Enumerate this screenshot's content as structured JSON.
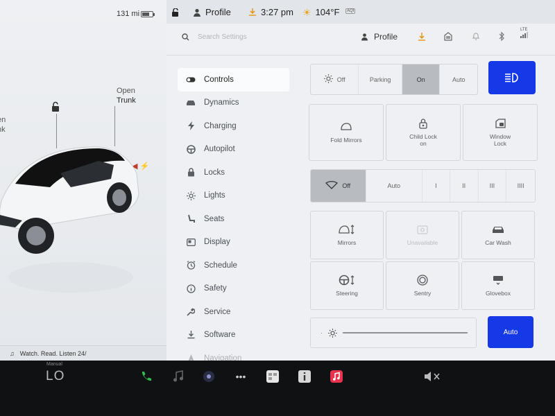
{
  "status": {
    "range": "131 mi",
    "battery_level": 0.65,
    "profile": "Profile",
    "time": "3:27 pm",
    "temperature": "104°F",
    "aqi_badge": "AQI"
  },
  "car": {
    "open_trunk_top": "Open",
    "open_trunk_bottom": "Trunk",
    "frunk_top": "en",
    "frunk_bottom": "nk",
    "charge_glyph": "⚡"
  },
  "media": {
    "music_text": "Watch. Read. Listen 24/"
  },
  "header": {
    "search_placeholder": "Search Settings",
    "profile": "Profile",
    "lte": "LTE"
  },
  "sidebar": {
    "items": [
      {
        "label": "Controls",
        "icon": "toggle-icon"
      },
      {
        "label": "Dynamics",
        "icon": "car-icon"
      },
      {
        "label": "Charging",
        "icon": "bolt-icon"
      },
      {
        "label": "Autopilot",
        "icon": "steering-wheel-icon"
      },
      {
        "label": "Locks",
        "icon": "lock-icon"
      },
      {
        "label": "Lights",
        "icon": "sun-icon"
      },
      {
        "label": "Seats",
        "icon": "seat-icon"
      },
      {
        "label": "Display",
        "icon": "display-icon"
      },
      {
        "label": "Schedule",
        "icon": "clock-icon"
      },
      {
        "label": "Safety",
        "icon": "info-icon"
      },
      {
        "label": "Service",
        "icon": "wrench-icon"
      },
      {
        "label": "Software",
        "icon": "download-icon"
      },
      {
        "label": "Navigation",
        "icon": "navigation-icon"
      }
    ]
  },
  "controls": {
    "lights": [
      "Off",
      "Parking",
      "On",
      "Auto"
    ],
    "lights_selected": "On",
    "toggles": [
      {
        "label": "Fold Mirrors",
        "icon": "mirror-icon"
      },
      {
        "label": "Child Lock",
        "sub": "on",
        "icon": "child-lock-icon"
      },
      {
        "label": "Window",
        "sub": "Lock",
        "icon": "window-lock-icon"
      }
    ],
    "wipers": [
      "Off",
      "Auto",
      "I",
      "II",
      "III",
      "IIII"
    ],
    "wipers_selected": "Off",
    "tiles": [
      {
        "label": "Mirrors",
        "icon": "mirror-adjust-icon",
        "enabled": true
      },
      {
        "label": "Unavailable",
        "icon": "unavailable-icon",
        "enabled": false
      },
      {
        "label": "Car Wash",
        "icon": "car-wash-icon",
        "enabled": true
      },
      {
        "label": "Steering",
        "icon": "steering-adjust-icon",
        "enabled": true
      },
      {
        "label": "Sentry",
        "icon": "sentry-icon",
        "enabled": true
      },
      {
        "label": "Glovebox",
        "icon": "glovebox-icon",
        "enabled": true
      }
    ],
    "brightness_auto": "Auto"
  },
  "dock": {
    "temp_label": "Manual",
    "temp": "LO"
  },
  "colors": {
    "accent": "#1639e8",
    "selected": "#b8bbc0",
    "dock": "#101113"
  }
}
